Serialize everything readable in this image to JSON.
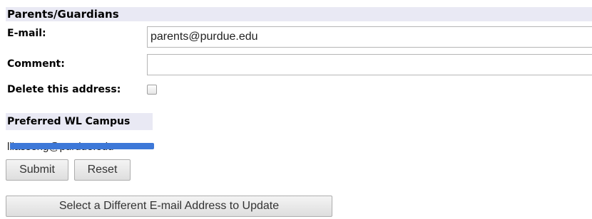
{
  "section": {
    "title": "Parents/Guardians"
  },
  "form": {
    "email_label": "E-mail:",
    "email_value": "parents@purdue.edu",
    "comment_label": "Comment:",
    "comment_value": "",
    "delete_label": "Delete this address:",
    "delete_checked": false
  },
  "preferred": {
    "heading": "Preferred WL Campus",
    "email_redacted_text": "lliasseng@purdue.edu"
  },
  "buttons": {
    "submit": "Submit",
    "reset": "Reset",
    "select_different": "Select a Different E-mail Address to Update"
  },
  "colors": {
    "header_bg": "#e9e9f4",
    "redaction_bar": "#3d78d8"
  }
}
